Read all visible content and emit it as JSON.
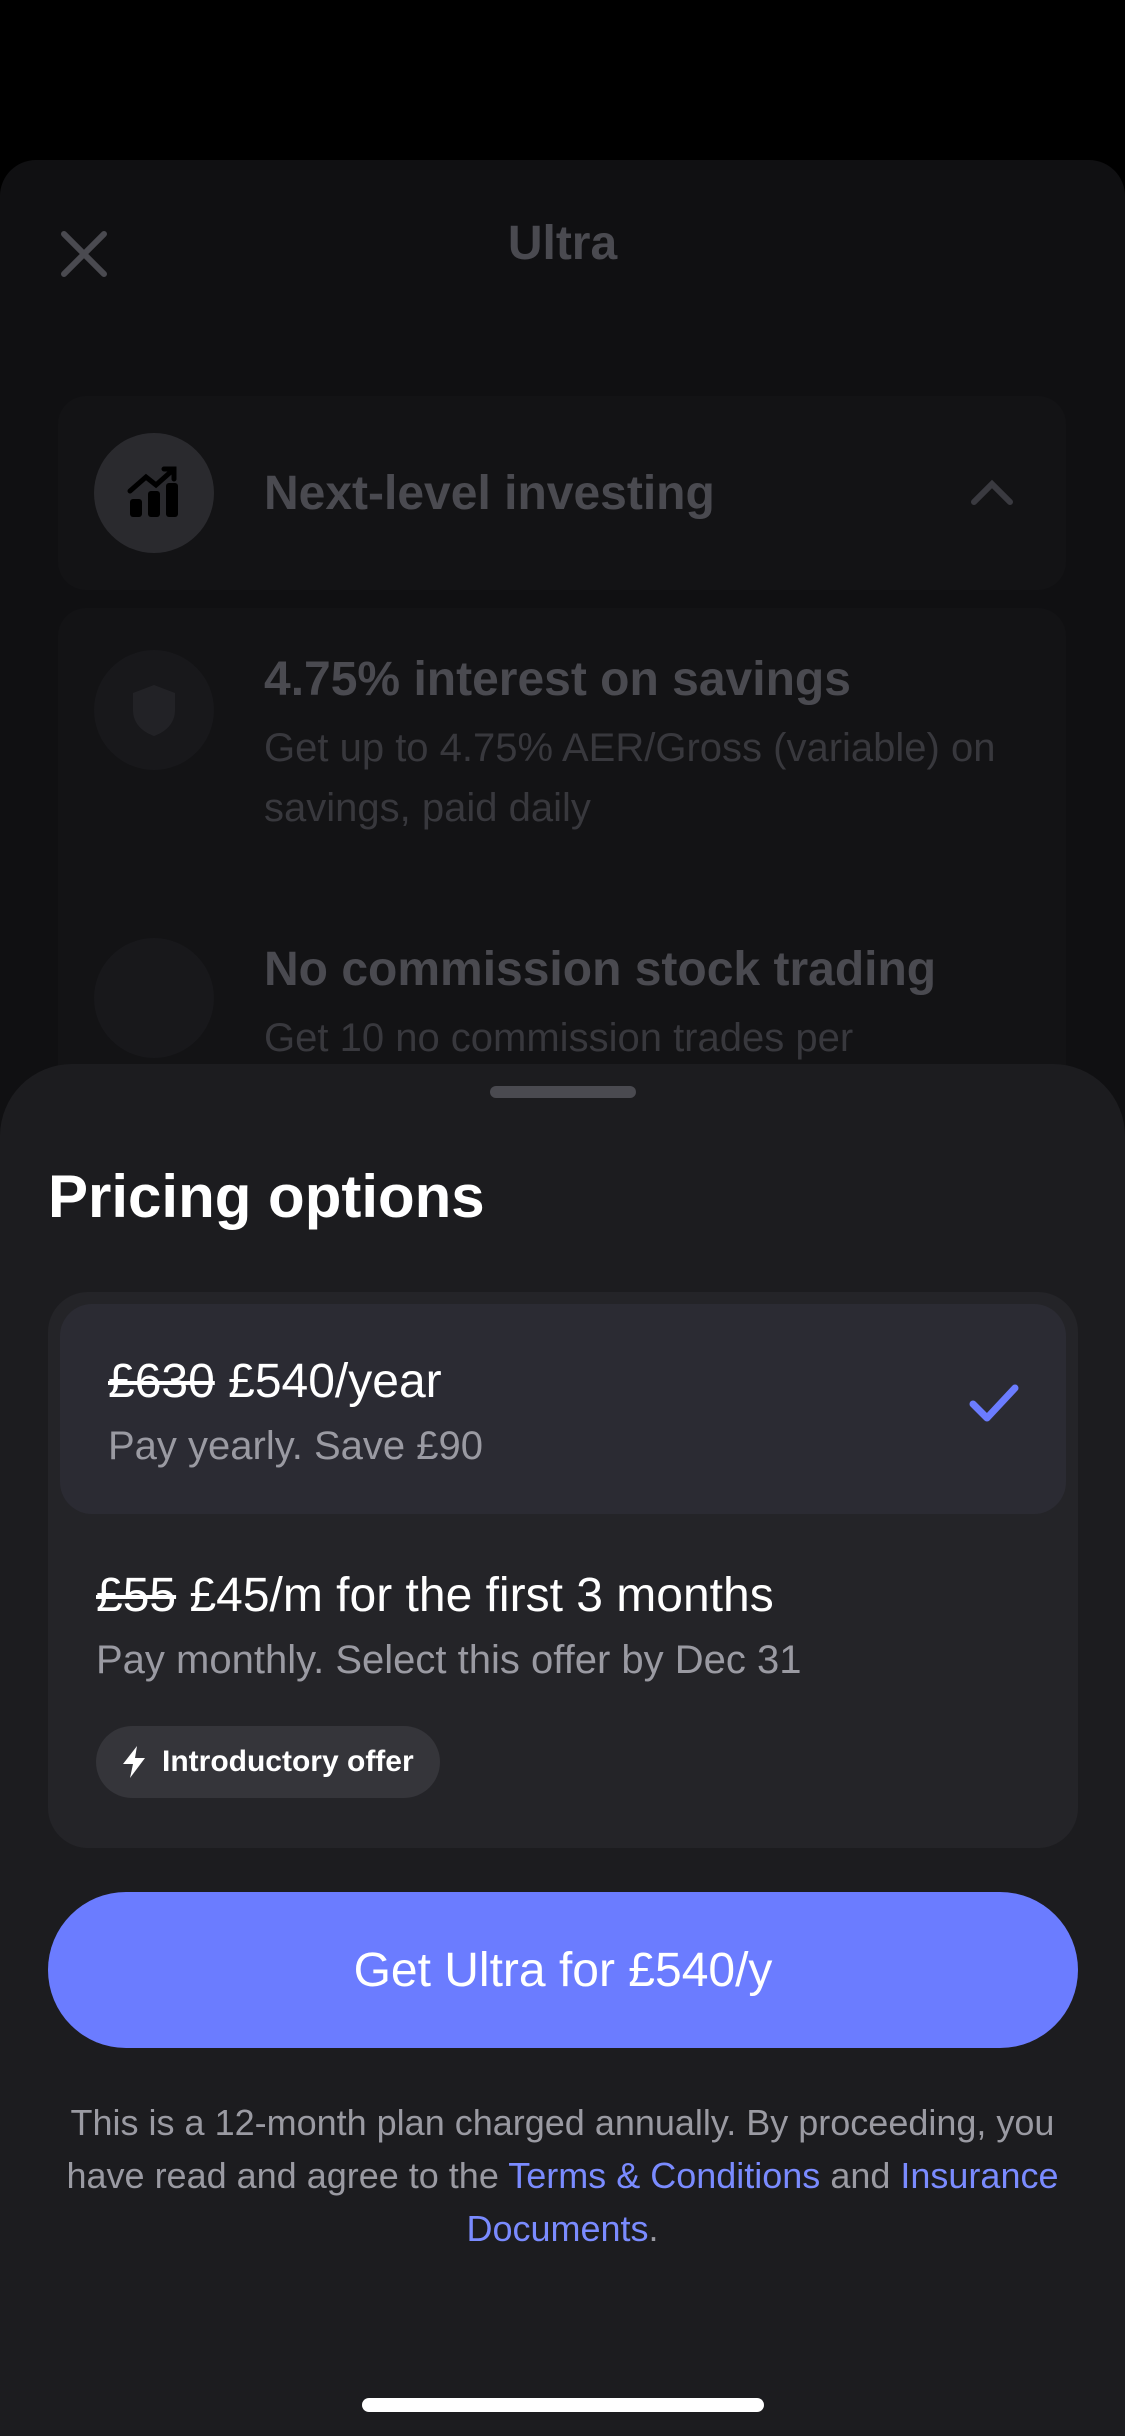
{
  "background": {
    "title": "Ultra",
    "features": [
      {
        "title": "Next-level investing"
      },
      {
        "title": "4.75% interest on savings",
        "description": "Get up to 4.75% AER/Gross (variable) on savings, paid daily"
      },
      {
        "title": "No commission stock trading",
        "description": "Get 10 no commission trades per"
      }
    ]
  },
  "sheet": {
    "title": "Pricing options",
    "options": [
      {
        "old_price": "£630",
        "price": "£540/year",
        "subtitle": "Pay yearly. Save £90",
        "selected": true
      },
      {
        "old_price": "£55",
        "price": "£45/m for the first 3 months",
        "subtitle": "Pay monthly. Select this offer by Dec 31",
        "badge": "Introductory offer"
      }
    ],
    "cta_label": "Get Ultra for £540/y",
    "legal": {
      "text_1": "This is a 12-month plan charged annually. By proceeding, you have read and agree to the ",
      "link_terms": "Terms & Conditions",
      "text_2": " and ",
      "link_insurance": "Insurance Documents",
      "text_3": "."
    }
  },
  "colors": {
    "accent": "#6b7cff",
    "sheet": "#1c1c1f",
    "card": "#242428",
    "selected": "#2b2b33"
  },
  "icons": [
    "close-icon",
    "chart-icon",
    "chevron-up-icon",
    "shield-icon",
    "check-icon",
    "bolt-icon"
  ]
}
